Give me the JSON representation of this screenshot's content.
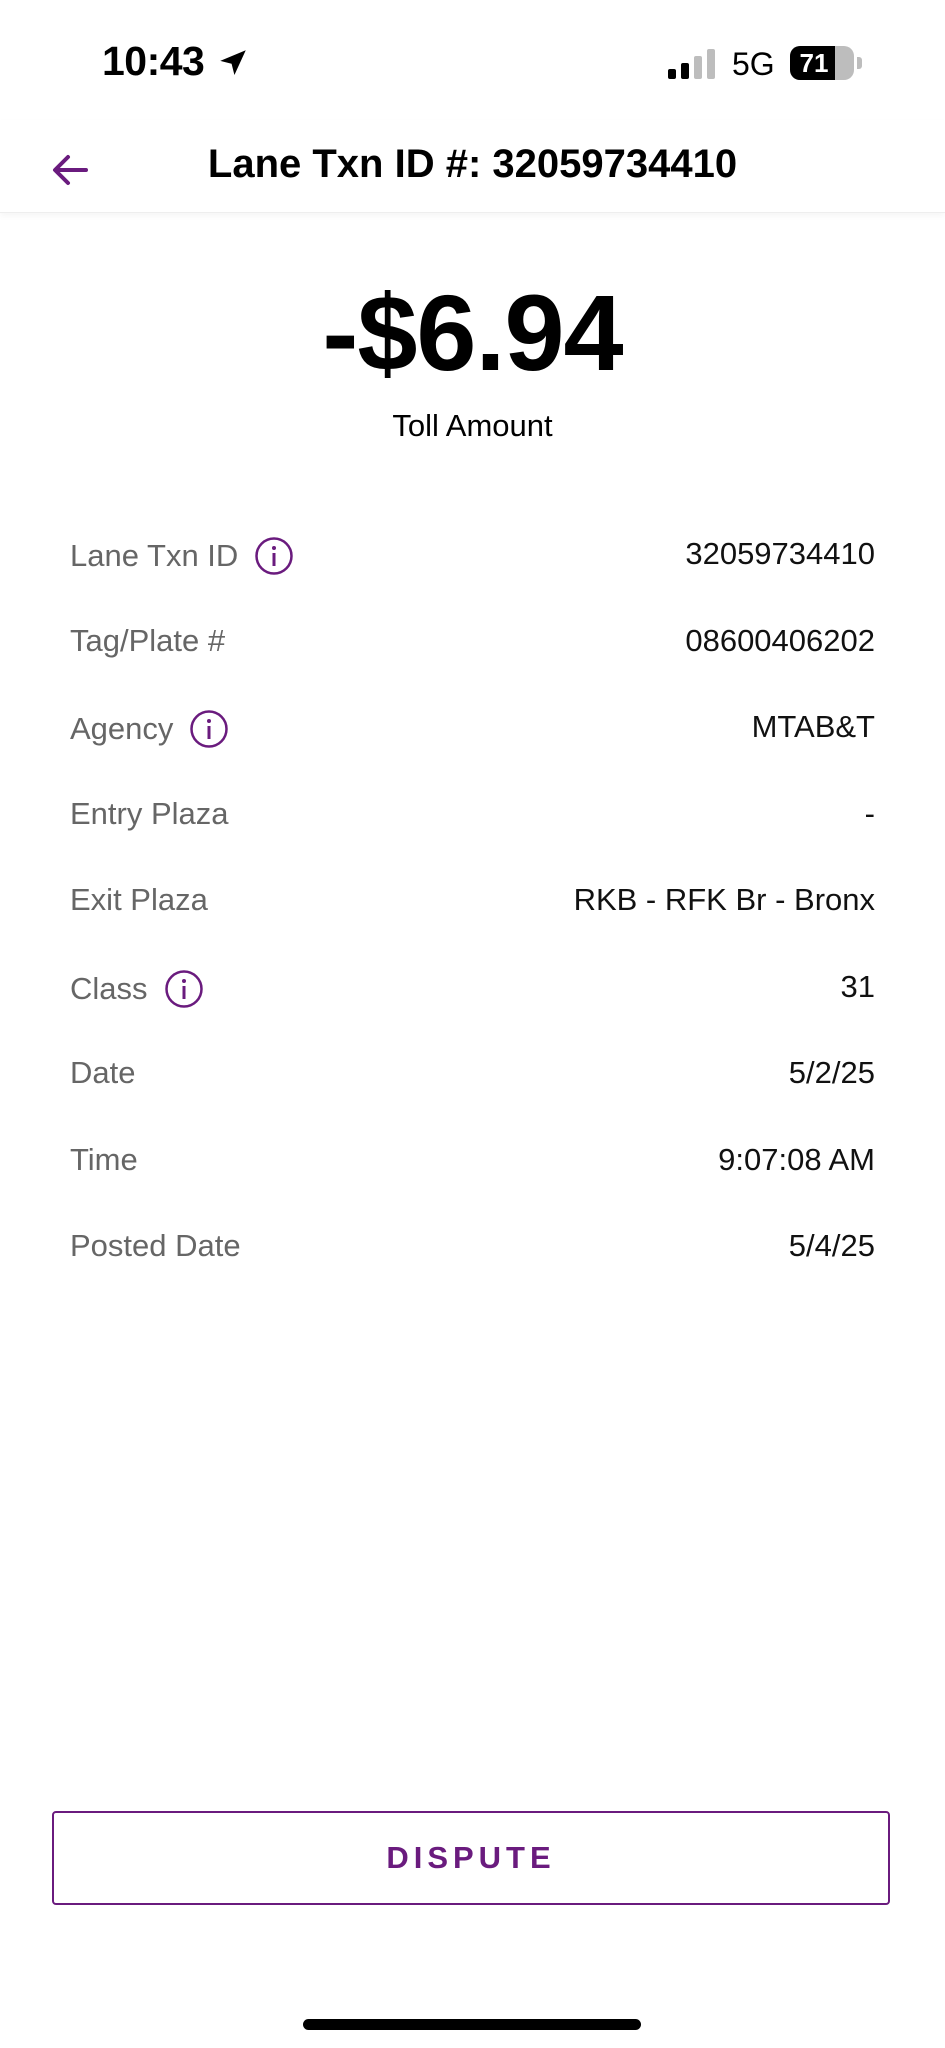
{
  "status_bar": {
    "time": "10:43",
    "network": "5G",
    "battery_level": "71",
    "battery_fraction": 0.71
  },
  "header": {
    "title": "Lane Txn ID #: 32059734410",
    "back_icon": "arrow-left-icon"
  },
  "summary": {
    "amount": "-$6.94",
    "amount_label": "Toll Amount"
  },
  "details": [
    {
      "label": "Lane Txn ID",
      "value": "32059734410",
      "info": true
    },
    {
      "label": "Tag/Plate #",
      "value": "08600406202",
      "info": false
    },
    {
      "label": "Agency",
      "value": "MTAB&T",
      "info": true
    },
    {
      "label": "Entry Plaza",
      "value": "-",
      "info": false
    },
    {
      "label": "Exit Plaza",
      "value": "RKB - RFK Br - Bronx",
      "info": false
    },
    {
      "label": "Class",
      "value": "31",
      "info": true
    },
    {
      "label": "Date",
      "value": "5/2/25",
      "info": false
    },
    {
      "label": "Time",
      "value": "9:07:08 AM",
      "info": false
    },
    {
      "label": "Posted Date",
      "value": "5/4/25",
      "info": false
    }
  ],
  "actions": {
    "dispute_label": "DISPUTE"
  },
  "colors": {
    "accent": "#6a1b7e",
    "label_text": "#666666"
  }
}
